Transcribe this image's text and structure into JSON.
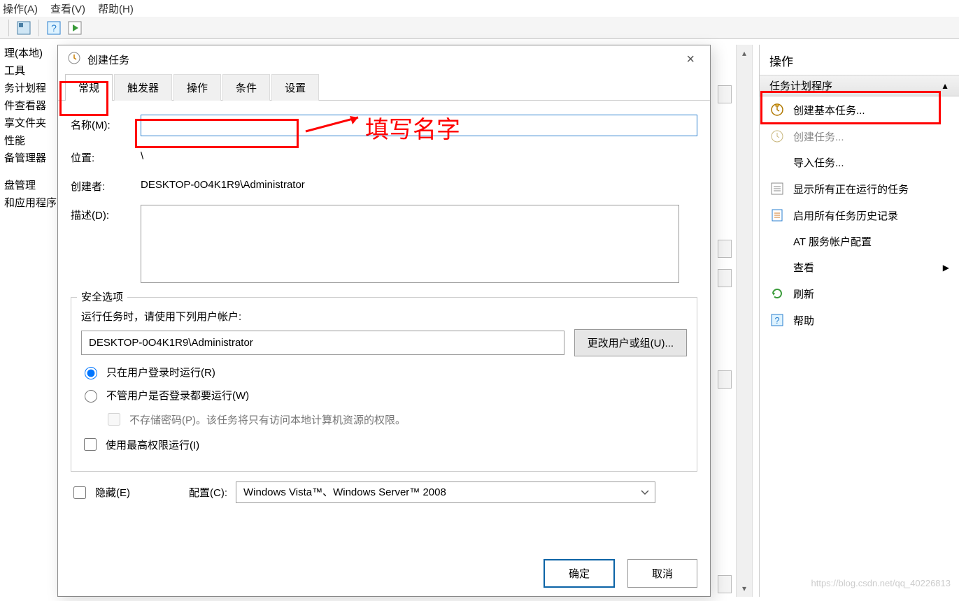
{
  "menu": {
    "action": "操作(A)",
    "view": "查看(V)",
    "help": "帮助(H)"
  },
  "tree": {
    "items": [
      "理(本地)",
      "工具",
      "务计划程",
      "件查看器",
      "享文件夹",
      "性能",
      "备管理器",
      "盘管理",
      "和应用程序"
    ]
  },
  "dialog": {
    "title": "创建任务",
    "tabs": {
      "general": "常规",
      "triggers": "触发器",
      "actions": "操作",
      "conditions": "条件",
      "settings": "设置"
    },
    "labels": {
      "name": "名称(M):",
      "location": "位置:",
      "author": "创建者:",
      "desc": "描述(D):"
    },
    "values": {
      "location": "\\",
      "author": "DESKTOP-0O4K1R9\\Administrator"
    },
    "security": {
      "legend": "安全选项",
      "run_using": "运行任务时，请使用下列用户帐户:",
      "user": "DESKTOP-0O4K1R9\\Administrator",
      "change_btn": "更改用户或组(U)...",
      "radio1": "只在用户登录时运行(R)",
      "radio2": "不管用户是否登录都要运行(W)",
      "chk_nopw": "不存储密码(P)。该任务将只有访问本地计算机资源的权限。",
      "chk_highest": "使用最高权限运行(I)"
    },
    "hidden": "隐藏(E)",
    "config_label": "配置(C):",
    "config_value": "Windows Vista™、Windows Server™ 2008",
    "ok": "确定",
    "cancel": "取消"
  },
  "actions_panel": {
    "header": "操作",
    "subheader": "任务计划程序",
    "items": [
      {
        "label": "创建基本任务...",
        "icon": "clock"
      },
      {
        "label": "创建任务...",
        "icon": "clock-dim"
      },
      {
        "label": "导入任务...",
        "icon": ""
      },
      {
        "label": "显示所有正在运行的任务",
        "icon": "list"
      },
      {
        "label": "启用所有任务历史记录",
        "icon": "doc"
      },
      {
        "label": "AT 服务帐户配置",
        "icon": ""
      },
      {
        "label": "查看",
        "icon": "",
        "arrow": true
      },
      {
        "label": "刷新",
        "icon": "refresh"
      },
      {
        "label": "帮助",
        "icon": "help"
      }
    ]
  },
  "annotations": {
    "fill_name": "填写名字"
  },
  "watermark": "https://blog.csdn.net/qq_40226813"
}
